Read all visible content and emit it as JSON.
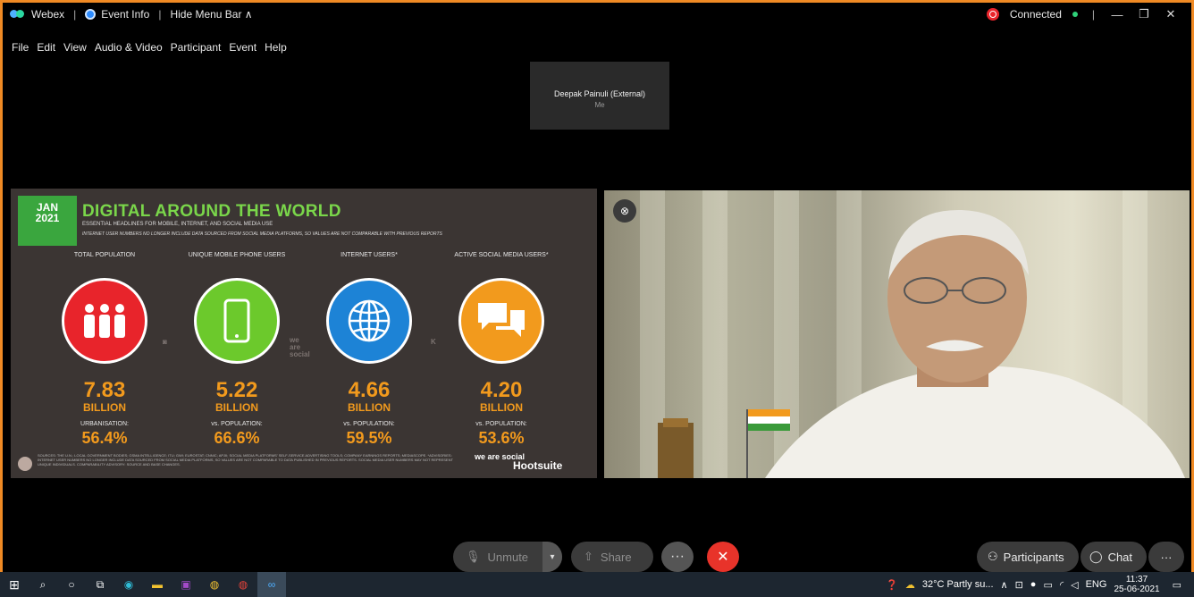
{
  "titlebar": {
    "app_name": "Webex",
    "event_info": "Event Info",
    "hide_menu": "Hide Menu Bar ∧",
    "status": "Connected",
    "min": "—",
    "restore": "❐",
    "close": "✕"
  },
  "menu": [
    "File",
    "Edit",
    "View",
    "Audio & Video",
    "Participant",
    "Event",
    "Help"
  ],
  "self_view": {
    "name": "Deepak Painuli (External)",
    "sub": "Me"
  },
  "slide": {
    "month": "JAN",
    "year": "2021",
    "title": "DIGITAL AROUND THE WORLD",
    "subtitle": "ESSENTIAL HEADLINES FOR MOBILE, INTERNET, AND SOCIAL MEDIA USE",
    "note": "INTERNET USER NUMBERS NO LONGER INCLUDE DATA SOURCED FROM SOCIAL MEDIA PLATFORMS, SO VALUES ARE NOT COMPARABLE WITH PREVIOUS REPORTS",
    "stats": [
      {
        "label": "TOTAL POPULATION",
        "value": "7.83",
        "unit": "BILLION",
        "sub": "URBANISATION:",
        "pct": "56.4%",
        "color": "#e8242b"
      },
      {
        "label": "UNIQUE MOBILE PHONE USERS",
        "value": "5.22",
        "unit": "BILLION",
        "sub": "vs. POPULATION:",
        "pct": "66.6%",
        "color": "#6cc92c"
      },
      {
        "label": "INTERNET USERS*",
        "value": "4.66",
        "unit": "BILLION",
        "sub": "vs. POPULATION:",
        "pct": "59.5%",
        "color": "#1d83d6"
      },
      {
        "label": "ACTIVE SOCIAL MEDIA USERS*",
        "value": "4.20",
        "unit": "BILLION",
        "sub": "vs. POPULATION:",
        "pct": "53.6%",
        "color": "#f29a1d"
      }
    ],
    "footnote": "SOURCES: THE U.N.; LOCAL GOVERNMENT BODIES; GSMA INTELLIGENCE; ITU; GWI; EUROSTAT; CNNIC; APJII; SOCIAL MEDIA PLATFORMS' SELF-SERVICE ADVERTISING TOOLS; COMPANY EARNINGS REPORTS; MEDIASCOPE. *ADVISORIES: INTERNET USER NUMBERS NO LONGER INCLUDE DATA SOURCED FROM SOCIAL MEDIA PLATFORMS, SO VALUES ARE NOT COMPARABLE TO DATA PUBLISHED IN PREVIOUS REPORTS. SOCIAL MEDIA USER NUMBERS MAY NOT REPRESENT UNIQUE INDIVIDUALS. COMPARABILITY ADVISORY: SOURCE AND BASE CHANGES.",
    "we_are_social": "we are social",
    "hootsuite": "Hootsuite"
  },
  "controls": {
    "unmute": "Unmute",
    "share": "Share",
    "more": "···",
    "end": "✕",
    "participants": "Participants",
    "chat": "Chat",
    "overflow": "···"
  },
  "taskbar": {
    "weather": "32°C  Partly su...",
    "lang": "ENG",
    "time": "11:37",
    "date": "25-06-2021"
  }
}
